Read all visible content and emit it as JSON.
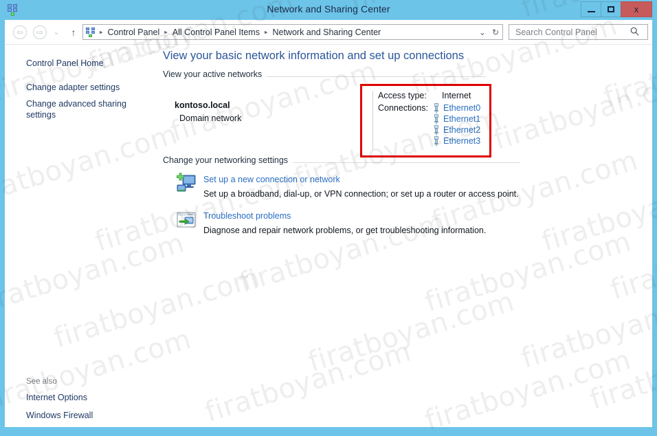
{
  "window": {
    "title": "Network and Sharing Center",
    "icon": "network-icon",
    "controls": {
      "minimize": "minimize-button",
      "maximize": "maximize-button",
      "close_label": "x"
    },
    "accent_color": "#6cc4e8",
    "close_color": "#c75b5b"
  },
  "navbar": {
    "back": "back-button",
    "forward": "forward-button",
    "recent": "v",
    "up": "↑",
    "path_icon": "network-icon",
    "breadcrumbs": [
      "Control Panel",
      "All Control Panel Items",
      "Network and Sharing Center"
    ],
    "separator": "▸",
    "dropdown": "⌄",
    "refresh": "↻"
  },
  "search": {
    "placeholder": "Search Control Panel",
    "value": "",
    "icon": "search-icon"
  },
  "sidebar": {
    "home": "Control Panel Home",
    "links": [
      "Change adapter settings",
      "Change advanced sharing settings"
    ],
    "see_also_label": "See also",
    "see_also": [
      "Internet Options",
      "Windows Firewall"
    ]
  },
  "main": {
    "heading": "View your basic network information and set up connections",
    "active_networks_section": "View your active networks",
    "network": {
      "name": "kontoso.local",
      "type": "Domain network",
      "access_type_label": "Access type:",
      "access_type_value": "Internet",
      "connections_label": "Connections:",
      "connections": [
        "Ethernet0",
        "Ethernet1",
        "Ethernet2",
        "Ethernet3"
      ]
    },
    "highlight_color": "#e00000",
    "change_settings_section": "Change your networking settings",
    "tasks": [
      {
        "icon": "new-connection-icon",
        "link": "Set up a new connection or network",
        "description": "Set up a broadband, dial-up, or VPN connection; or set up a router or access point."
      },
      {
        "icon": "troubleshoot-icon",
        "link": "Troubleshoot problems",
        "description": "Diagnose and repair network problems, or get troubleshooting information."
      }
    ]
  },
  "watermark": {
    "text": "firatboyan.com"
  }
}
